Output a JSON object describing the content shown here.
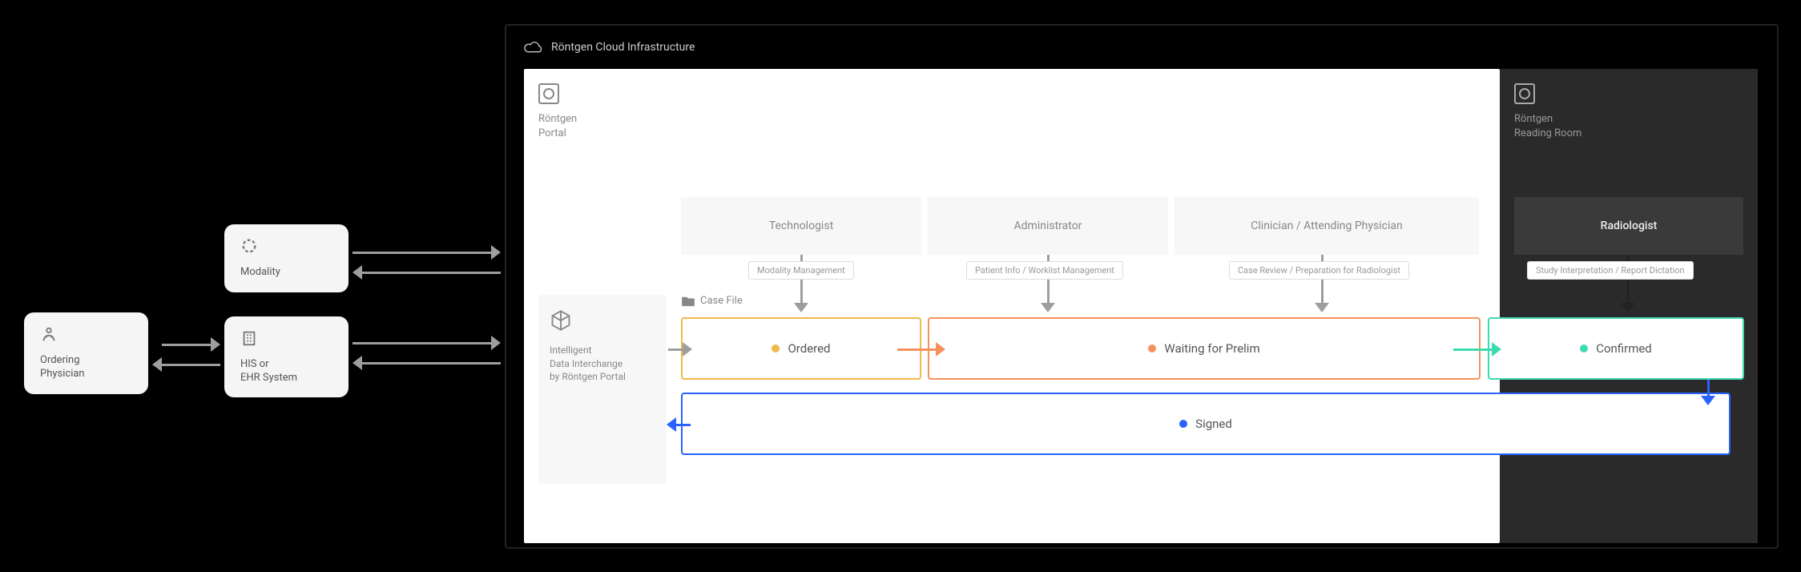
{
  "external": {
    "modality": "Modality",
    "ordering_physician": "Ordering\nPhysician",
    "his_ehr": "HIS or\nEHR System"
  },
  "cloud": {
    "title": "Röntgen Cloud Infrastructure"
  },
  "portal": {
    "brand": "Röntgen",
    "name": "Portal"
  },
  "reading_room": {
    "brand": "Röntgen",
    "name": "Reading Room"
  },
  "roles": {
    "technologist": "Technologist",
    "administrator": "Administrator",
    "clinician": "Clinician / Attending Physician",
    "radiologist": "Radiologist"
  },
  "tasks": {
    "modality_mgmt": "Modality Management",
    "patient_worklist": "Patient Info / Worklist Management",
    "case_review": "Case Review / Preparation for Radiologist",
    "study_interp": "Study Interpretation / Report Dictation"
  },
  "idi": {
    "label": "Intelligent\nData Interchange\nby Röntgen Portal"
  },
  "case_file_label": "Case File",
  "stages": {
    "ordered": "Ordered",
    "waiting": "Waiting for Prelim",
    "confirmed": "Confirmed",
    "signed": "Signed"
  },
  "colors": {
    "ordered": "#f0b94a",
    "waiting": "#f5915e",
    "confirmed": "#3ddbb0",
    "signed": "#2962ff",
    "signed_dot": "#2962ff",
    "grey_arrow": "#9e9e9e"
  }
}
